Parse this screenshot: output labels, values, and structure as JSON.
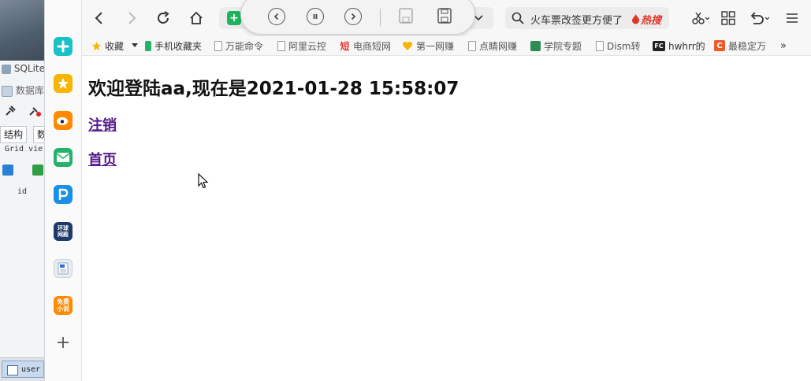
{
  "background_app": {
    "title": "SQLite",
    "menu_label": "数据库",
    "tab_structure": "结构",
    "tab_data_partial": "数",
    "grid_view_label": "Grid vie",
    "column_id": "id",
    "status_table": "user"
  },
  "sidebar": {
    "items": [
      {
        "name": "app-store-icon",
        "color": "#19c2c8"
      },
      {
        "name": "favorites-icon",
        "color": "#f7b500"
      },
      {
        "name": "weibo-icon",
        "color": "#ff8a00"
      },
      {
        "name": "mail-icon",
        "color": "#22b26a"
      },
      {
        "name": "pdf-icon",
        "color": "#1a8fe6"
      },
      {
        "name": "global-times-icon",
        "color": "#1f3a68",
        "text": "环球\n网殿"
      },
      {
        "name": "word-icon",
        "color": "#e9edf3"
      },
      {
        "name": "free-novel-icon",
        "color": "#ff8a00",
        "text": "免费\n小说"
      },
      {
        "name": "add-icon",
        "color": "#555555"
      }
    ]
  },
  "search": {
    "text": "火车票改签更方便了",
    "hot_label": "热搜"
  },
  "bookmarks": [
    {
      "label": "收藏",
      "icon": "star-icon",
      "color": "#f7b500"
    },
    {
      "label": "手机收藏夹",
      "icon": "phone-icon",
      "color": "#22b26a"
    },
    {
      "label": "万能命令",
      "icon": "doc-icon"
    },
    {
      "label": "阿里云控",
      "icon": "doc-icon"
    },
    {
      "label": "电商短网",
      "icon": "short-icon",
      "color": "#e0332a",
      "text": "短"
    },
    {
      "label": "第一网赚",
      "icon": "heart-icon",
      "color": "#f7b500"
    },
    {
      "label": "点睛网赚",
      "icon": "doc-icon"
    },
    {
      "label": "学院专题",
      "icon": "academy-icon",
      "color": "#2e8b57"
    },
    {
      "label": "Dism转",
      "icon": "doc-icon"
    },
    {
      "label": "hwhrr的",
      "icon": "fc-icon",
      "color": "#222222",
      "text": "FC"
    },
    {
      "label": "最稳定万",
      "icon": "c-icon",
      "color": "#f05a28",
      "text": "C"
    }
  ],
  "bookmarks_more": "»",
  "page": {
    "welcome": "欢迎登陆aa,现在是2021-01-28 15:58:07",
    "logout_link": "注销",
    "home_link": "首页"
  }
}
